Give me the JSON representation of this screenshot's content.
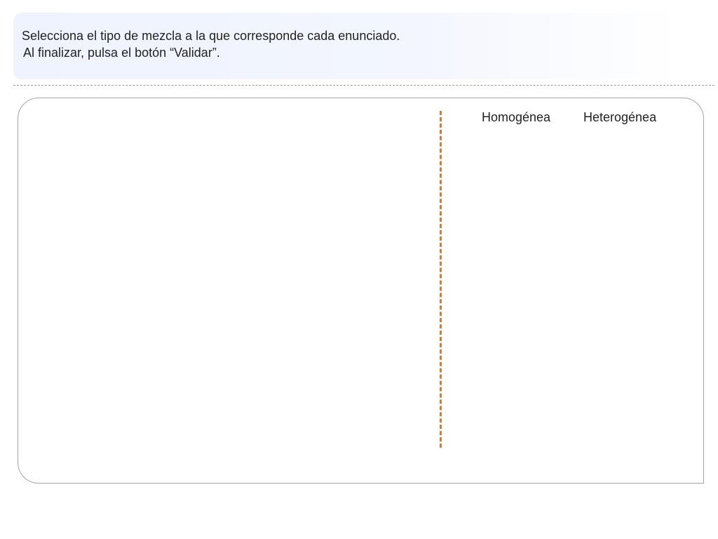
{
  "instructions": {
    "line1": "Selecciona el tipo de mezcla a la que corresponde cada enunciado.",
    "line2": "Al finalizar, pulsa el botón “Validar”."
  },
  "activity": {
    "columns": [
      {
        "label": "Homogénea"
      },
      {
        "label": "Heterogénea"
      }
    ],
    "separator_color": "#e07a1a"
  }
}
